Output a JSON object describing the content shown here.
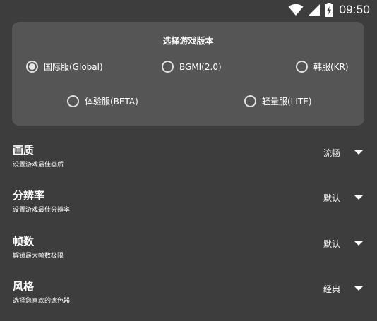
{
  "status_bar": {
    "time": "09:50",
    "icons": [
      "wifi-icon",
      "signal-icon",
      "battery-charging-icon"
    ]
  },
  "version_card": {
    "title": "选择游戏版本",
    "options": [
      {
        "label": "国际服(Global)",
        "selected": true
      },
      {
        "label": "BGMI(2.0)",
        "selected": false
      },
      {
        "label": "韩服(KR)",
        "selected": false
      },
      {
        "label": "体验服(BETA)",
        "selected": false
      },
      {
        "label": "轻量服(LITE)",
        "selected": false
      }
    ]
  },
  "settings": [
    {
      "title": "画质",
      "desc": "设置游戏最佳画质",
      "value": "流畅"
    },
    {
      "title": "分辨率",
      "desc": "设置游戏最佳分辨率",
      "value": "默认"
    },
    {
      "title": "帧数",
      "desc": "解锁最大帧数极限",
      "value": "默认"
    },
    {
      "title": "风格",
      "desc": "选择您喜欢的滤色器",
      "value": "经典"
    }
  ],
  "colors": {
    "background": "#3d3d3d",
    "card": "#555555",
    "text": "#ffffff"
  }
}
